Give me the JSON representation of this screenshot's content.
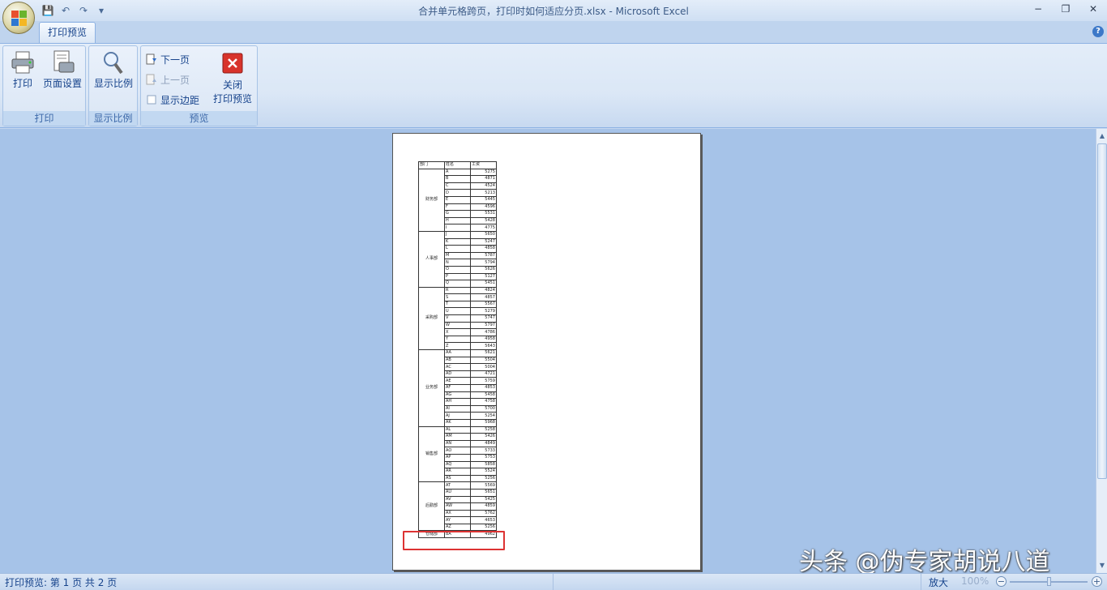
{
  "window": {
    "title": "合并单元格跨页，打印时如何适应分页.xlsx - Microsoft Excel",
    "minimize": "−",
    "restore": "❐",
    "close": "✕"
  },
  "qat": {
    "save": "💾",
    "undo": "↶",
    "redo": "↷",
    "more": "▾"
  },
  "tabs": {
    "active": "打印预览",
    "help": "?"
  },
  "ribbon": {
    "print_group": {
      "label": "打印",
      "print": "打印",
      "page_setup": "页面设置"
    },
    "zoom_group": {
      "label": "显示比例",
      "zoom": "显示比例"
    },
    "preview_group": {
      "label": "预览",
      "next_page": "下一页",
      "prev_page": "上一页",
      "show_margins": "显示边距",
      "close_line1": "关闭",
      "close_line2": "打印预览"
    }
  },
  "sheet": {
    "headers": [
      "部门",
      "姓名",
      "工资"
    ],
    "departments": [
      {
        "name": "财务部",
        "rows": [
          [
            "A",
            "5275"
          ],
          [
            "B",
            "4871"
          ],
          [
            "C",
            "4524"
          ],
          [
            "D",
            "5213"
          ],
          [
            "E",
            "5445"
          ],
          [
            "F",
            "4596"
          ],
          [
            "G",
            "5531"
          ],
          [
            "H",
            "5428"
          ],
          [
            "I",
            "4775"
          ]
        ]
      },
      {
        "name": "人事部",
        "rows": [
          [
            "J",
            "5650"
          ],
          [
            "K",
            "5247"
          ],
          [
            "L",
            "4858"
          ],
          [
            "M",
            "5787"
          ],
          [
            "N",
            "5794"
          ],
          [
            "O",
            "5626"
          ],
          [
            "P",
            "5127"
          ],
          [
            "Q",
            "5451"
          ]
        ]
      },
      {
        "name": "采购部",
        "rows": [
          [
            "R",
            "4824"
          ],
          [
            "S",
            "4857"
          ],
          [
            "T",
            "5567"
          ],
          [
            "U",
            "5279"
          ],
          [
            "V",
            "5747"
          ],
          [
            "W",
            "5797"
          ],
          [
            "X",
            "4786"
          ],
          [
            "Y",
            "4958"
          ],
          [
            "Z",
            "5643"
          ]
        ]
      },
      {
        "name": "业务部",
        "rows": [
          [
            "AA",
            "5621"
          ],
          [
            "AB",
            "5504"
          ],
          [
            "AC",
            "5004"
          ],
          [
            "AD",
            "4721"
          ],
          [
            "AE",
            "5759"
          ],
          [
            "AF",
            "4853"
          ],
          [
            "AG",
            "5458"
          ],
          [
            "AH",
            "4758"
          ],
          [
            "AI",
            "5700"
          ],
          [
            "AJ",
            "5254"
          ],
          [
            "AK",
            "5968"
          ]
        ]
      },
      {
        "name": "销售部",
        "rows": [
          [
            "AL",
            "5258"
          ],
          [
            "AM",
            "5426"
          ],
          [
            "AN",
            "4849"
          ],
          [
            "AO",
            "5733"
          ],
          [
            "AP",
            "5753"
          ],
          [
            "AQ",
            "5858"
          ],
          [
            "AR",
            "5524"
          ],
          [
            "AS",
            "5256"
          ]
        ]
      },
      {
        "name": "后勤部",
        "rows": [
          [
            "AT",
            "5569"
          ],
          [
            "AU",
            "5651"
          ],
          [
            "AV",
            "5425"
          ],
          [
            "AW",
            "4859"
          ],
          [
            "AX",
            "5762"
          ],
          [
            "AY",
            "4653"
          ],
          [
            "AZ",
            "5256"
          ]
        ]
      },
      {
        "name": "仓储部",
        "rows": [
          [
            "BA",
            "4962"
          ]
        ]
      }
    ]
  },
  "watermark": "头条 @伪专家胡说八道",
  "status": {
    "text": "打印预览: 第 1 页  共 2 页",
    "zoom_label": "放大",
    "zoom_pct": "100%",
    "zoom_minus": "−",
    "zoom_plus": "+"
  }
}
